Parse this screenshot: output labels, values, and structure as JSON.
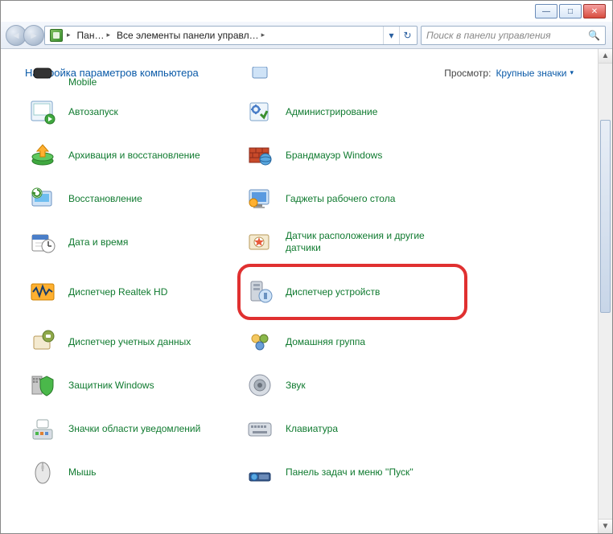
{
  "window_controls": {
    "min": "—",
    "max": "□",
    "close": "✕"
  },
  "nav": {
    "back_glyph": "◄",
    "fwd_glyph": "►"
  },
  "breadcrumb": {
    "seg1": "Пан…",
    "seg2": "Все элементы панели управл…",
    "sep": "▸",
    "dropdown_glyph": "▾",
    "refresh_glyph": "↻"
  },
  "search": {
    "placeholder": "Поиск в панели управления",
    "mag": "🔍"
  },
  "page_title": "Настройка параметров компьютера",
  "view": {
    "label": "Просмотр:",
    "value": "Крупные значки",
    "tri": "▾"
  },
  "items_left": [
    {
      "id": "mobile",
      "label": "Mobile"
    },
    {
      "id": "autoplay",
      "label": "Автозапуск"
    },
    {
      "id": "backup",
      "label": "Архивация и восстановление"
    },
    {
      "id": "recovery",
      "label": "Восстановление"
    },
    {
      "id": "datetime",
      "label": "Дата и время"
    },
    {
      "id": "realtek",
      "label": "Диспетчер Realtek HD"
    },
    {
      "id": "credmgr",
      "label": "Диспетчер учетных данных"
    },
    {
      "id": "defender",
      "label": "Защитник Windows"
    },
    {
      "id": "notifications",
      "label": "Значки области уведомлений"
    },
    {
      "id": "mouse",
      "label": "Мышь"
    }
  ],
  "items_right": [
    {
      "id": "blank",
      "label": ""
    },
    {
      "id": "admin",
      "label": "Администрирование"
    },
    {
      "id": "firewall",
      "label": "Брандмауэр Windows"
    },
    {
      "id": "gadgets",
      "label": "Гаджеты рабочего стола"
    },
    {
      "id": "sensors",
      "label": "Датчик расположения и другие датчики"
    },
    {
      "id": "devmgr",
      "label": "Диспетчер устройств",
      "highlighted": true
    },
    {
      "id": "homegroup",
      "label": "Домашняя группа"
    },
    {
      "id": "sound",
      "label": "Звук"
    },
    {
      "id": "keyboard",
      "label": "Клавиатура"
    },
    {
      "id": "taskbar",
      "label": "Панель задач и меню ''Пуск''"
    }
  ]
}
